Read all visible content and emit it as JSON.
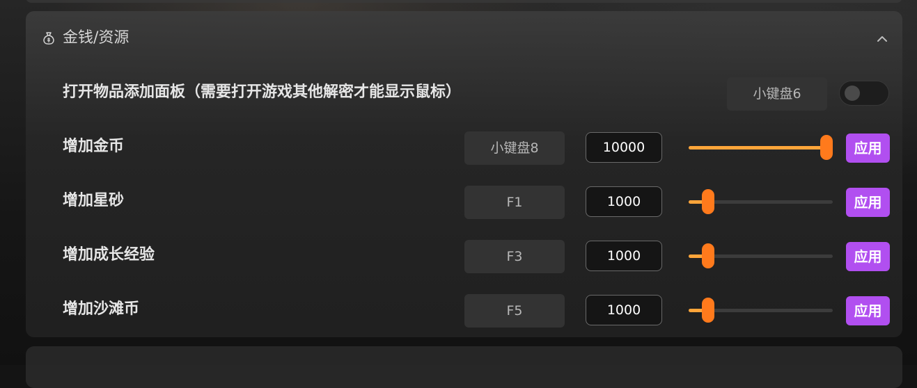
{
  "section": {
    "title": "金钱/资源",
    "icon": "money-bag-icon",
    "collapse_icon": "chevron-up-icon"
  },
  "item_panel": {
    "label": "打开物品添加面板（需要打开游戏其他解密才能显示鼠标）",
    "hotkey": "小键盘6",
    "toggle_on": false
  },
  "rows": [
    {
      "label": "增加金币",
      "hotkey": "小键盘8",
      "value": "10000",
      "slider_fraction": 1.0,
      "apply": "应用"
    },
    {
      "label": "增加星砂",
      "hotkey": "F1",
      "value": "1000",
      "slider_fraction": 0.1,
      "apply": "应用"
    },
    {
      "label": "增加成长经验",
      "hotkey": "F3",
      "value": "1000",
      "slider_fraction": 0.1,
      "apply": "应用"
    },
    {
      "label": "增加沙滩币",
      "hotkey": "F5",
      "value": "1000",
      "slider_fraction": 0.1,
      "apply": "应用"
    }
  ],
  "colors": {
    "accent_apply": "#b14ff0",
    "slider_fill": "#ffa53a",
    "slider_thumb": "#ff7a1c"
  }
}
